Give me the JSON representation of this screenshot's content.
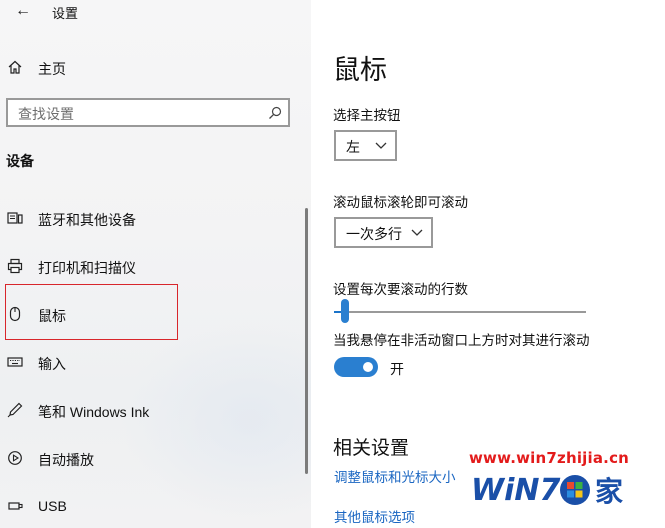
{
  "window": {
    "back_icon": "back-arrow-icon",
    "title": "设置"
  },
  "sidebar": {
    "home": {
      "label": "主页",
      "icon": "home-icon"
    },
    "search": {
      "placeholder": "查找设置",
      "icon": "search-icon"
    },
    "section_header": "设备",
    "items": [
      {
        "label": "蓝牙和其他设备",
        "icon": "bluetooth-devices-icon"
      },
      {
        "label": "打印机和扫描仪",
        "icon": "printer-icon"
      },
      {
        "label": "鼠标",
        "icon": "mouse-icon",
        "selected": true
      },
      {
        "label": "输入",
        "icon": "keyboard-icon"
      },
      {
        "label": "笔和 Windows Ink",
        "icon": "pen-icon"
      },
      {
        "label": "自动播放",
        "icon": "autoplay-icon"
      },
      {
        "label": "USB",
        "icon": "usb-icon"
      }
    ]
  },
  "main": {
    "title": "鼠标",
    "primary_button": {
      "label": "选择主按钮",
      "value": "左"
    },
    "scroll_wheel": {
      "label": "滚动鼠标滚轮即可滚动",
      "value": "一次多行"
    },
    "lines_to_scroll": {
      "label": "设置每次要滚动的行数",
      "level_fraction": 0.03
    },
    "inactive_scroll": {
      "label": "当我悬停在非活动窗口上方时对其进行滚动",
      "state_label": "开",
      "on": true
    },
    "related": {
      "header": "相关设置",
      "links": [
        "调整鼠标和光标大小",
        "其他鼠标选项"
      ]
    }
  },
  "watermark": {
    "url": "www.win7zhijia.cn",
    "logo_text": "WiN7",
    "logo_suffix": "家"
  },
  "colors": {
    "accent": "#2a7fd0",
    "link": "#1a66c2",
    "highlight_border": "#d8262b",
    "watermark_red": "#e31b1b",
    "watermark_blue": "#1a4fa8"
  }
}
